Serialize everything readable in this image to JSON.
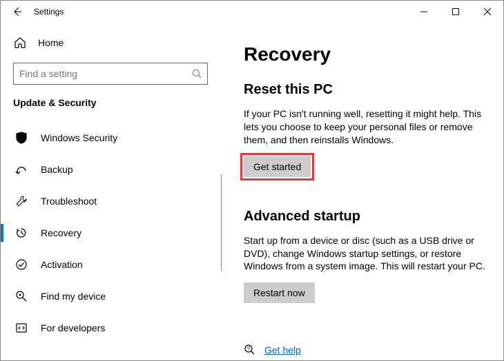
{
  "window": {
    "title": "Settings"
  },
  "sidebar": {
    "home_label": "Home",
    "search_placeholder": "Find a setting",
    "section_label": "Update & Security",
    "items": [
      {
        "icon": "shield",
        "label": "Windows Security"
      },
      {
        "icon": "backup",
        "label": "Backup"
      },
      {
        "icon": "wrench",
        "label": "Troubleshoot"
      },
      {
        "icon": "recovery",
        "label": "Recovery"
      },
      {
        "icon": "check",
        "label": "Activation"
      },
      {
        "icon": "find",
        "label": "Find my device"
      },
      {
        "icon": "dev",
        "label": "For developers"
      }
    ],
    "active_index": 3
  },
  "main": {
    "title": "Recovery",
    "reset": {
      "heading": "Reset this PC",
      "body": "If your PC isn't running well, resetting it might help. This lets you choose to keep your personal files or remove them, and then reinstalls Windows.",
      "button": "Get started"
    },
    "advanced": {
      "heading": "Advanced startup",
      "body": "Start up from a device or disc (such as a USB drive or DVD), change Windows startup settings, or restore Windows from a system image. This will restart your PC.",
      "button": "Restart now"
    },
    "help_link": "Get help"
  }
}
